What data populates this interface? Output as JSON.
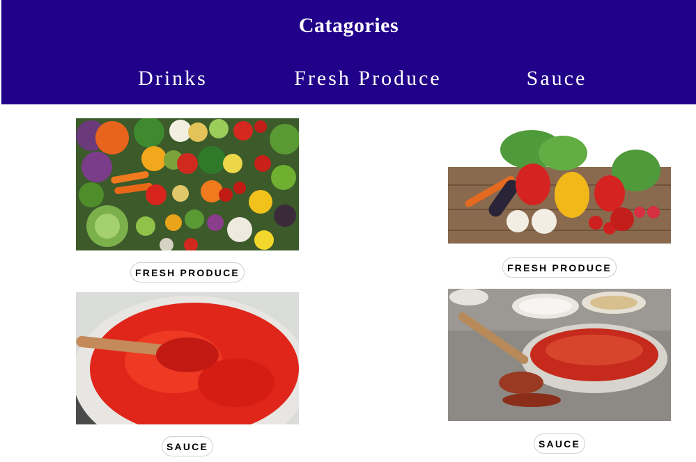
{
  "header": {
    "title": "Catagories",
    "nav": [
      {
        "label": "Drinks"
      },
      {
        "label": "Fresh Produce"
      },
      {
        "label": "Sauce"
      }
    ]
  },
  "cards": [
    {
      "label": "FRESH PRODUCE",
      "image": "vegetable-assortment-image"
    },
    {
      "label": "FRESH PRODUCE",
      "image": "vegetables-on-wood-image"
    },
    {
      "label": "SAUCE",
      "image": "tomato-sauce-pot-image"
    },
    {
      "label": "SAUCE",
      "image": "sauce-bowl-spoon-image"
    }
  ],
  "colors": {
    "header_bg": "#21008a",
    "header_text": "#ffffff",
    "pill_border": "#cfcfcf"
  }
}
